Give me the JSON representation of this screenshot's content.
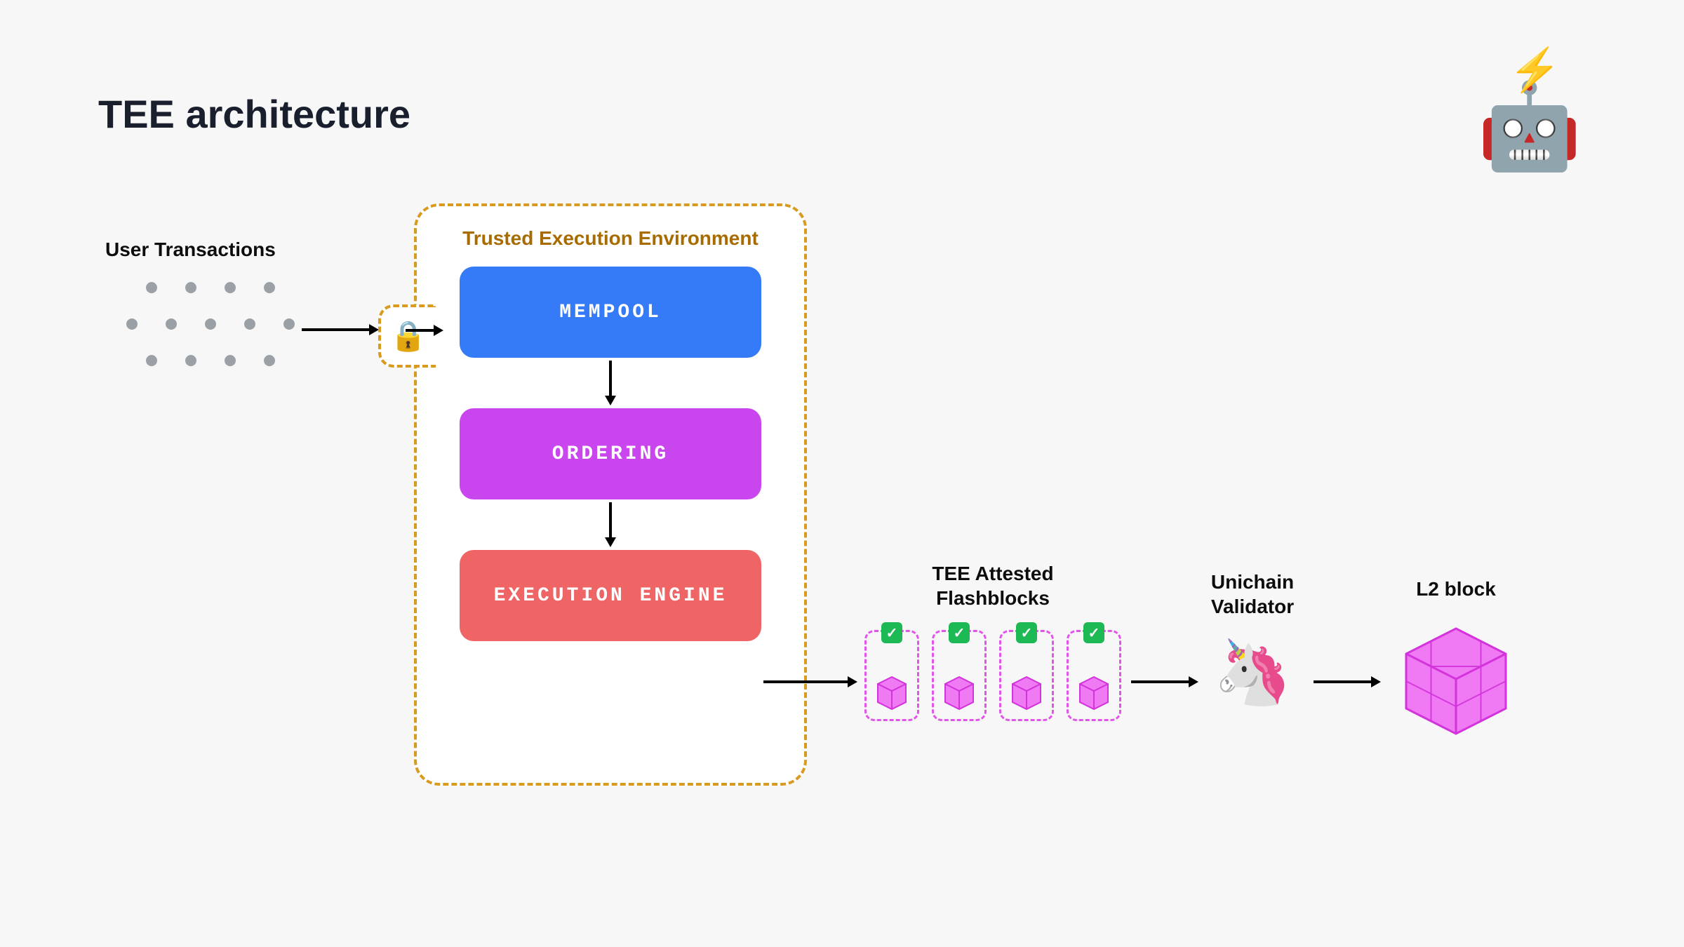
{
  "title": "TEE architecture",
  "user_tx_label": "User Transactions",
  "tee": {
    "container_label": "Trusted Execution Environment",
    "stages": {
      "mempool": "MEMPOOL",
      "ordering": "ORDERING",
      "execution": "EXECUTION ENGINE"
    }
  },
  "flashblocks": {
    "label_line1": "TEE Attested",
    "label_line2": "Flashblocks",
    "count": 4
  },
  "validator": {
    "label_line1": "Unichain",
    "label_line2": "Validator"
  },
  "l2_label": "L2 block",
  "icons": {
    "lock": "lock-icon",
    "robot": "flashbots-robot-icon",
    "unicorn": "unicorn-icon",
    "checkmark": "checkmark-icon",
    "cube": "cube-icon"
  },
  "colors": {
    "mempool": "#357af6",
    "ordering": "#c946ee",
    "execution": "#ef6464",
    "tee_border": "#d89a1f",
    "magenta": "#e055e8",
    "magenta_fill": "#ef7af3",
    "check_green": "#1db954"
  }
}
